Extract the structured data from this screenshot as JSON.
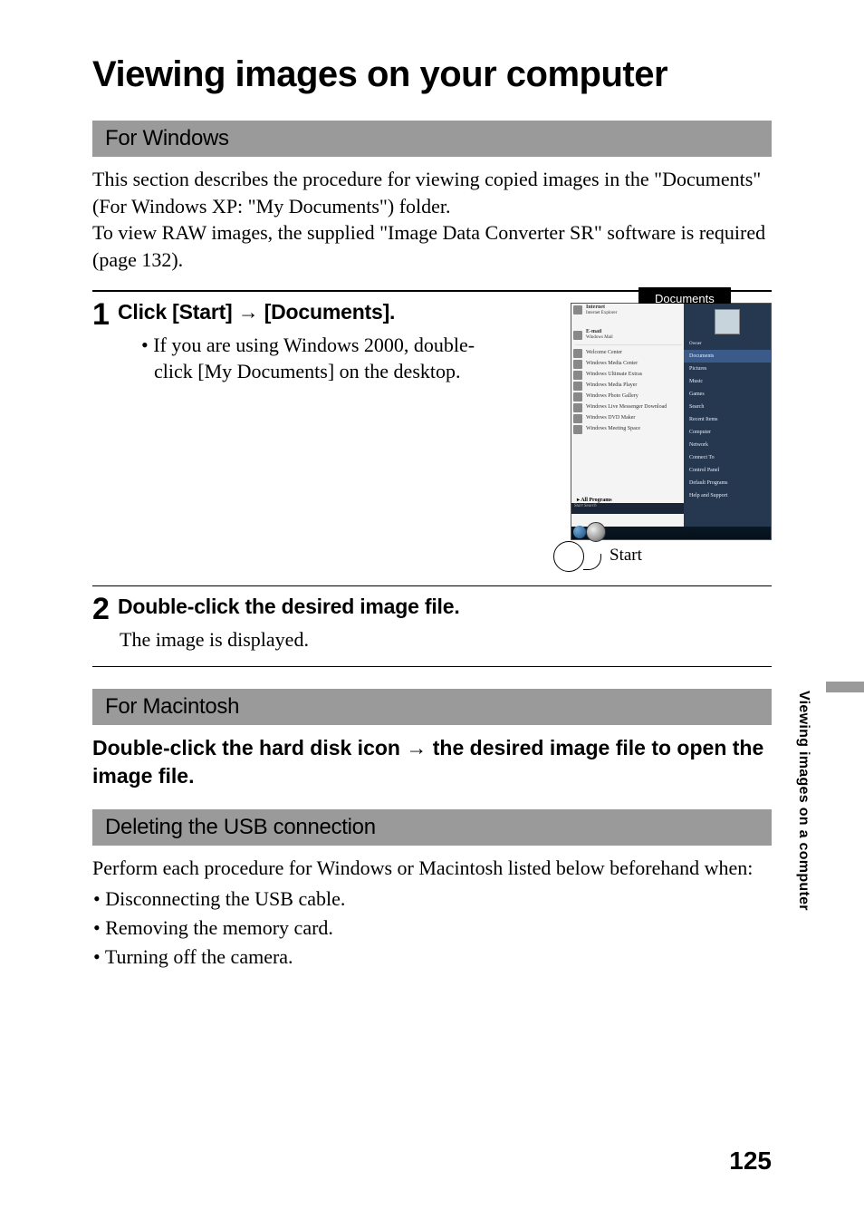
{
  "title": "Viewing images on your computer",
  "section_windows": "For Windows",
  "intro": "This section describes the procedure for viewing copied images in the \"Documents\" (For Windows XP: \"My Documents\") folder.\nTo view RAW images, the supplied \"Image Data Converter SR\" software is required (page 132).",
  "step1": {
    "num": "1",
    "heading_a": "Click [Start] ",
    "heading_b": " [Documents].",
    "bullet": "If you are using Windows 2000, double-click [My Documents] on the desktop."
  },
  "callout_documents": "Documents",
  "start_label": "Start",
  "start_menu": {
    "top1": "Internet",
    "top1_sub": "Internet Explorer",
    "top2": "E-mail",
    "top2_sub": "Windows Mail",
    "left": [
      "Welcome Center",
      "Windows Media Center",
      "Windows Ultimate Extras",
      "Windows Media Player",
      "Windows Photo Gallery",
      "Windows Live Messenger Download",
      "Windows DVD Maker",
      "Windows Meeting Space"
    ],
    "right_owner": "Owner",
    "right": [
      "Documents",
      "Pictures",
      "Music",
      "Games",
      "Search",
      "Recent Items",
      "Computer",
      "Network",
      "Connect To",
      "Control Panel",
      "Default Programs",
      "Help and Support"
    ],
    "all_programs": "All Programs",
    "search_placeholder": "Start Search"
  },
  "step2": {
    "num": "2",
    "heading": "Double-click the desired image file.",
    "body": "The image is displayed."
  },
  "section_mac": "For Macintosh",
  "mac_heading_a": "Double-click the hard disk icon ",
  "mac_heading_b": " the desired image file to open the image file.",
  "section_usb": "Deleting the USB connection",
  "usb_intro": "Perform each procedure for Windows or Macintosh listed below beforehand when:",
  "usb_bullets": [
    "Disconnecting the USB cable.",
    "Removing the memory card.",
    "Turning off the camera."
  ],
  "sidebar": "Viewing images on a computer",
  "page_number": "125",
  "arrow": "→"
}
